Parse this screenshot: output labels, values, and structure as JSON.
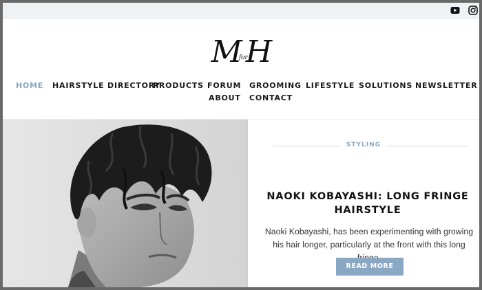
{
  "topbar": {
    "icons": [
      "youtube-icon",
      "instagram-icon"
    ]
  },
  "logo": {
    "m": "M",
    "for": "for",
    "h": "H"
  },
  "nav": {
    "items": [
      {
        "label": "HOME",
        "active": true
      },
      {
        "label": "HAIRSTYLE DIRECTORY"
      },
      {
        "label": "PRODUCTS"
      },
      {
        "label": "FORUM"
      },
      {
        "label": "GROOMING"
      },
      {
        "label": "LIFESTYLE"
      },
      {
        "label": "SOLUTIONS"
      },
      {
        "label": "NEWSLETTER"
      },
      {
        "label": "ABOUT"
      },
      {
        "label": "CONTACT"
      }
    ]
  },
  "article": {
    "category": "STYLING",
    "title": "NAOKI KOBAYASHI: LONG FRINGE HAIRSTYLE",
    "excerpt": "Naoki Kobayashi, has been experimenting with growing his hair longer, particularly at the front with this long fringe.",
    "button": "READ MORE",
    "image": "portrait of man with long fringe hairstyle"
  },
  "colors": {
    "accent": "#8aa8c3",
    "topbar": "#eef2f4",
    "text": "#111111"
  }
}
